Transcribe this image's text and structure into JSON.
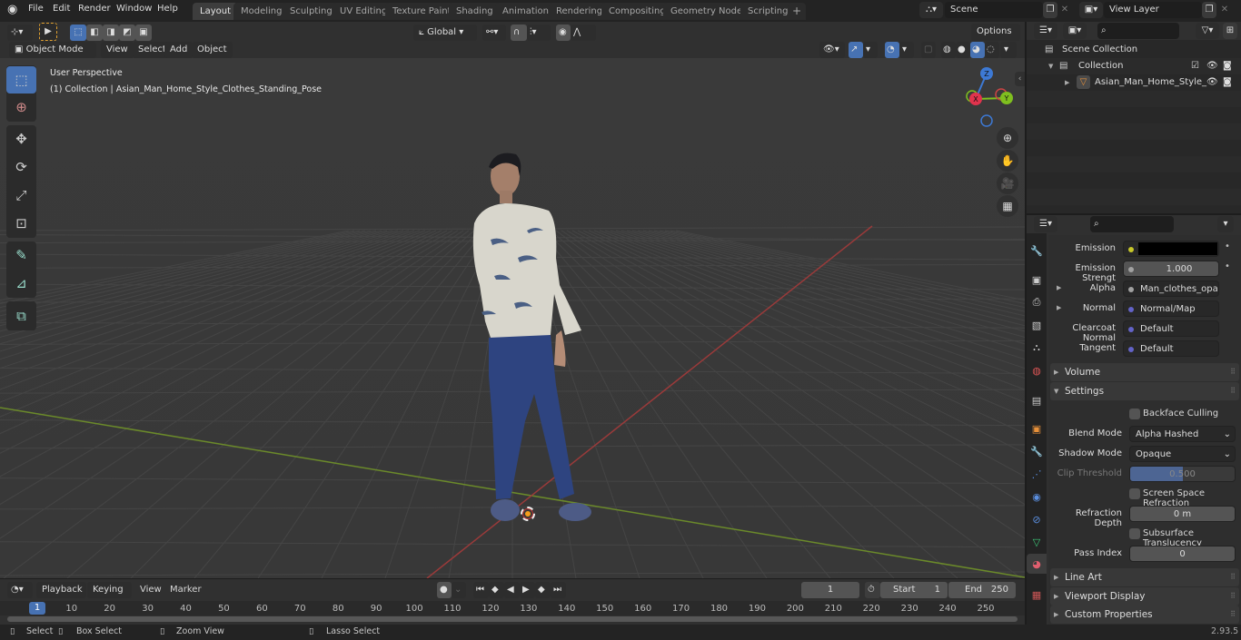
{
  "app": {
    "logo_icon": "blender-logo-icon",
    "menu": [
      "File",
      "Edit",
      "Render",
      "Window",
      "Help"
    ],
    "workspaces": [
      "Layout",
      "Modeling",
      "Sculpting",
      "UV Editing",
      "Texture Paint",
      "Shading",
      "Animation",
      "Rendering",
      "Compositing",
      "Geometry Nodes",
      "Scripting"
    ],
    "active_workspace": "Layout",
    "add_workspace": "+",
    "scene": "Scene",
    "view_layer": "View Layer",
    "version": "2.93.5"
  },
  "viewport": {
    "mode": "Object Mode",
    "menus": [
      "View",
      "Select",
      "Add",
      "Object"
    ],
    "transform_orientation": "Global",
    "options_label": "Options",
    "overlay_title": "User Perspective",
    "overlay_subtitle": "(1) Collection | Asian_Man_Home_Style_Clothes_Standing_Pose",
    "gizmo_axes": {
      "x": "X",
      "y": "Y",
      "z": "Z"
    },
    "tools": [
      "select-box-icon",
      "cursor-icon",
      "move-icon",
      "rotate-icon",
      "scale-icon",
      "transform-icon",
      "annotate-icon",
      "measure-icon",
      "add-cube-icon"
    ],
    "nav_buttons": [
      "zoom-icon",
      "pan-hand-icon",
      "camera-view-icon",
      "ortho-grid-icon"
    ],
    "shading_modes": [
      "wireframe",
      "solid",
      "material-preview",
      "rendered"
    ],
    "active_shading": "material-preview"
  },
  "outliner": {
    "search_placeholder": "",
    "items": [
      {
        "label": "Scene Collection",
        "icon": "scene-collection-icon"
      },
      {
        "label": "Collection",
        "icon": "collection-icon",
        "checked": true
      },
      {
        "label": "Asian_Man_Home_Style_",
        "icon": "mesh-object-icon"
      }
    ]
  },
  "properties": {
    "search_placeholder": "",
    "sockets": [
      {
        "label": "Emission",
        "value": "",
        "socket_color": "#c7c729",
        "type": "color",
        "color_value": "#000000"
      },
      {
        "label": "Emission Strengt",
        "value": "1.000",
        "socket_color": "#a1a1a1",
        "type": "number"
      },
      {
        "label": "Alpha",
        "value": "Man_clothes_opacit...",
        "socket_color": "#a1a1a1",
        "type": "link",
        "expand": true
      },
      {
        "label": "Normal",
        "value": "Normal/Map",
        "socket_color": "#6363c7",
        "type": "link",
        "expand": true
      },
      {
        "label": "Clearcoat Normal",
        "value": "Default",
        "socket_color": "#6363c7",
        "type": "link"
      },
      {
        "label": "Tangent",
        "value": "Default",
        "socket_color": "#6363c7",
        "type": "link"
      }
    ],
    "panels": {
      "volume": "Volume",
      "settings": "Settings",
      "line_art": "Line Art",
      "viewport_display": "Viewport Display",
      "custom_properties": "Custom Properties"
    },
    "settings": {
      "backface_culling": {
        "label": "Backface Culling",
        "checked": false
      },
      "blend_mode": {
        "label": "Blend Mode",
        "value": "Alpha Hashed"
      },
      "shadow_mode": {
        "label": "Shadow Mode",
        "value": "Opaque"
      },
      "clip_threshold": {
        "label": "Clip Threshold",
        "value": "0.500",
        "fraction": 0.5
      },
      "screen_space_refraction": {
        "label": "Screen Space Refraction",
        "checked": false
      },
      "refraction_depth": {
        "label": "Refraction Depth",
        "value": "0 m"
      },
      "subsurface_translucency": {
        "label": "Subsurface Translucency",
        "checked": false
      },
      "pass_index": {
        "label": "Pass Index",
        "value": "0"
      }
    },
    "tabs": [
      "tool",
      "render",
      "output",
      "view-layer",
      "scene",
      "world",
      "collection",
      "object",
      "modifiers",
      "particles",
      "physics",
      "constraints",
      "data",
      "material",
      "texture"
    ],
    "active_tab": "material"
  },
  "timeline": {
    "menus": [
      "Playback",
      "Keying",
      "View",
      "Marker"
    ],
    "current_frame": "1",
    "start_label": "Start",
    "start": "1",
    "end_label": "End",
    "end": "250",
    "ticks": [
      "10",
      "20",
      "30",
      "40",
      "50",
      "60",
      "70",
      "80",
      "90",
      "100",
      "110",
      "120",
      "130",
      "140",
      "150",
      "160",
      "170",
      "180",
      "190",
      "200",
      "210",
      "220",
      "230",
      "240",
      "250"
    ],
    "playhead": "1"
  },
  "statusbar": {
    "hints": [
      "Select",
      "Box Select",
      "Zoom View",
      "Lasso Select"
    ]
  }
}
